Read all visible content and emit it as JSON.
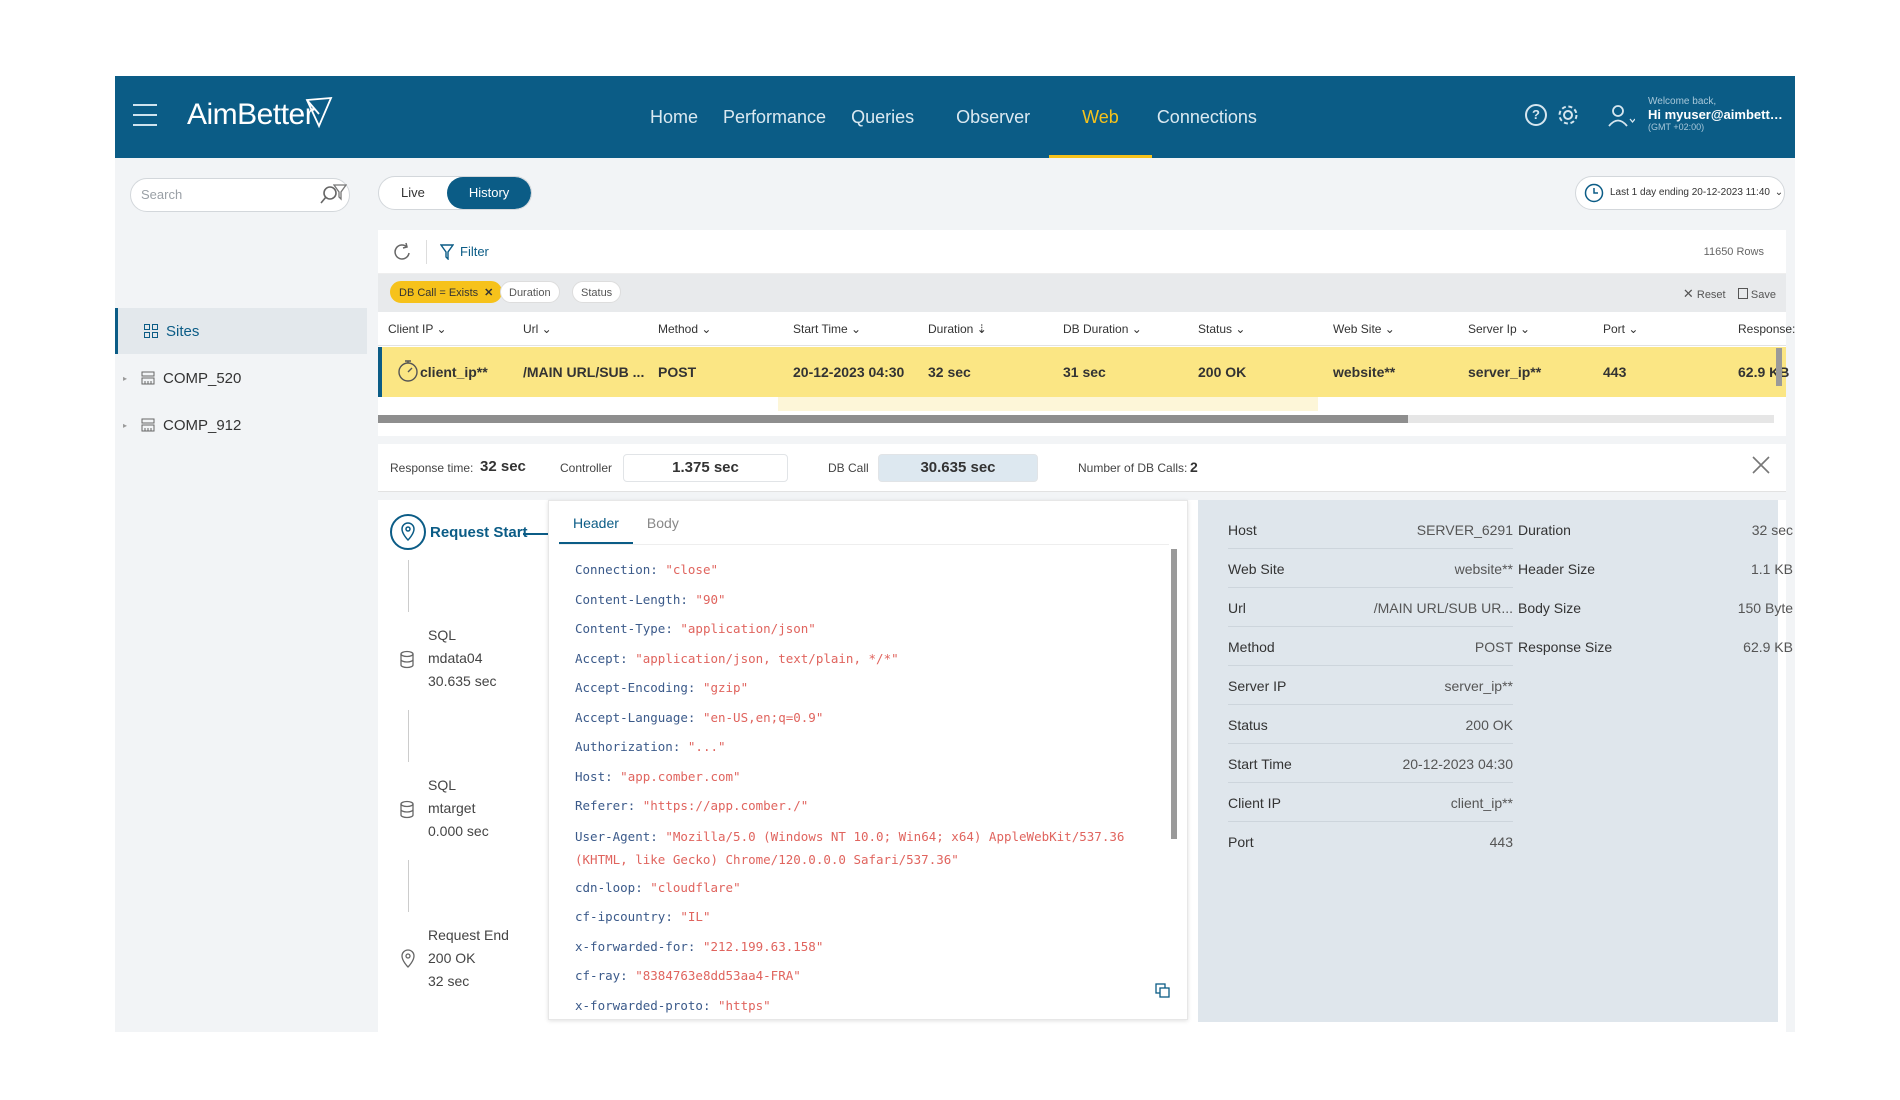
{
  "app": {
    "name": "AimBetter"
  },
  "nav": {
    "items": [
      {
        "label": "Home"
      },
      {
        "label": "Performance"
      },
      {
        "label": "Queries"
      },
      {
        "label": "Observer"
      },
      {
        "label": "Web"
      },
      {
        "label": "Connections"
      }
    ],
    "active": "Web"
  },
  "user": {
    "welcome": "Welcome back,",
    "name": "Hi myuser@aimbetter...",
    "timezone": "(GMT +02:00)"
  },
  "sidebar": {
    "search_placeholder": "Search",
    "items": [
      {
        "label": "Sites",
        "icon": "grid-icon"
      },
      {
        "label": "COMP_520",
        "icon": "server-icon"
      },
      {
        "label": "COMP_912",
        "icon": "server-icon"
      }
    ]
  },
  "mode": {
    "live": "Live",
    "history": "History",
    "active": "History"
  },
  "range": {
    "label": "Last 1 day ending",
    "value": "20-12-2023 11:40"
  },
  "grid": {
    "filter_label": "Filter",
    "rows_count": "11650 Rows",
    "chips": [
      "DB Call = Exists",
      "Duration",
      "Status"
    ],
    "reset_label": "Reset",
    "save_label": "Save",
    "columns": [
      "Client IP",
      "Url",
      "Method",
      "Start Time",
      "Duration",
      "DB Duration",
      "Status",
      "Web Site",
      "Server Ip",
      "Port",
      "Response"
    ],
    "row": {
      "client_ip": "client_ip**",
      "url": "/MAIN URL/SUB ...",
      "method": "POST",
      "start_time": "20-12-2023 04:30",
      "duration": "32 sec",
      "db_duration": "31 sec",
      "status": "200 OK",
      "web_site": "website**",
      "server_ip": "server_ip**",
      "port": "443",
      "response": "62.9 KB"
    }
  },
  "summary": {
    "response_time_label": "Response time:",
    "response_time": "32 sec",
    "controller_label": "Controller",
    "controller": "1.375 sec",
    "db_call_label": "DB Call",
    "db_call": "30.635 sec",
    "num_db_calls_label": "Number of DB Calls:",
    "num_db_calls": "2"
  },
  "timeline": {
    "start_label": "Request Start",
    "sql1": {
      "type": "SQL",
      "db": "mdata04",
      "duration": "30.635 sec"
    },
    "sql2": {
      "type": "SQL",
      "db": "mtarget",
      "duration": "0.000 sec"
    },
    "end": {
      "label": "Request End",
      "status": "200 OK",
      "duration": "32 sec"
    }
  },
  "detail_tabs": {
    "header": "Header",
    "body": "Body",
    "active": "Header"
  },
  "headers": [
    {
      "k": "Connection",
      "v": "\"close\""
    },
    {
      "k": "Content-Length",
      "v": "\"90\""
    },
    {
      "k": "Content-Type",
      "v": "\"application/json\""
    },
    {
      "k": "Accept",
      "v": "\"application/json, text/plain, */*\""
    },
    {
      "k": "Accept-Encoding",
      "v": "\"gzip\""
    },
    {
      "k": "Accept-Language",
      "v": "\"en-US,en;q=0.9\""
    },
    {
      "k": "Authorization",
      "v": "\"...\""
    },
    {
      "k": "Host",
      "v": "\"app.comber.com\""
    },
    {
      "k": "Referer",
      "v": "\"https://app.comber./\""
    },
    {
      "k": "User-Agent",
      "v": "\"Mozilla/5.0 (Windows NT 10.0; Win64; x64) AppleWebKit/537.36 (KHTML, like Gecko) Chrome/120.0.0.0 Safari/537.36\""
    },
    {
      "k": "cdn-loop",
      "v": "\"cloudflare\""
    },
    {
      "k": "cf-ipcountry",
      "v": "\"IL\""
    },
    {
      "k": "x-forwarded-for",
      "v": "\"212.199.63.158\""
    },
    {
      "k": "cf-ray",
      "v": "\"8384763e8dd53aa4-FRA\""
    },
    {
      "k": "x-forwarded-proto",
      "v": "\"https\""
    }
  ],
  "info_left": [
    {
      "k": "Host",
      "v": "SERVER_6291"
    },
    {
      "k": "Web Site",
      "v": "website**"
    },
    {
      "k": "Url",
      "v": "/MAIN URL/SUB UR..."
    },
    {
      "k": "Method",
      "v": "POST"
    },
    {
      "k": "Server IP",
      "v": "server_ip**"
    },
    {
      "k": "Status",
      "v": "200 OK"
    },
    {
      "k": "Start Time",
      "v": "20-12-2023 04:30"
    },
    {
      "k": "Client IP",
      "v": "client_ip**"
    },
    {
      "k": "Port",
      "v": "443"
    }
  ],
  "info_right": [
    {
      "k": "Duration",
      "v": "32 sec"
    },
    {
      "k": "Header Size",
      "v": "1.1 KB"
    },
    {
      "k": "Body Size",
      "v": "150 Byte"
    },
    {
      "k": "Response Size",
      "v": "62.9 KB"
    }
  ],
  "colors": {
    "brand": "#0b5c86",
    "accent": "#f6c21b",
    "row_highlight": "#fbe684",
    "header_value": "#e0645e"
  }
}
